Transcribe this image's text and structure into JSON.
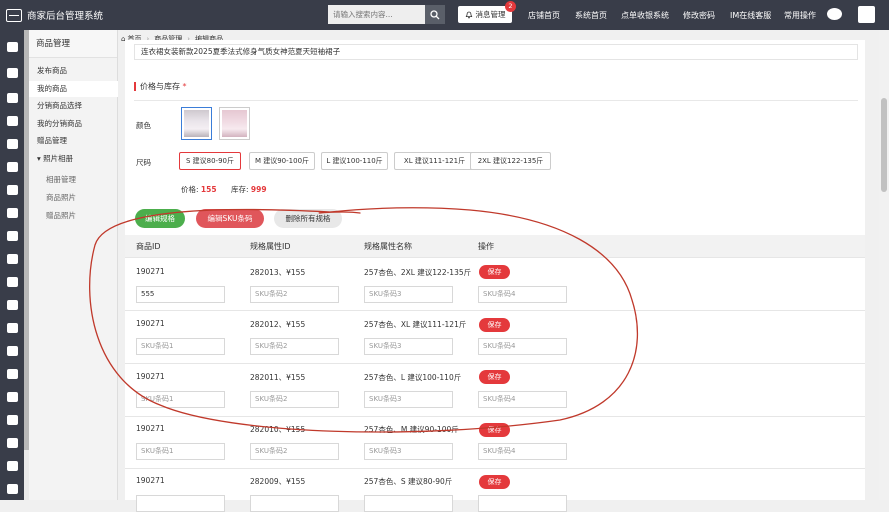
{
  "app": {
    "title": "商家后台管理系统"
  },
  "search": {
    "placeholder": "请输入搜索内容..."
  },
  "messages": {
    "label": "消息管理",
    "count": "2"
  },
  "topnav": [
    "店铺首页",
    "系统首页",
    "点单收银系统",
    "修改密码",
    "IM在线客服",
    "常用操作"
  ],
  "sidebar": {
    "title": "商品管理",
    "items": [
      "发布商品",
      "我的商品",
      "分销商品选择",
      "我的分销商品",
      "赠品管理",
      "照片相册",
      "相册管理",
      "商品照片",
      "赠品照片"
    ]
  },
  "breadcrumb": [
    "首页",
    "商品管理",
    "编辑商品"
  ],
  "product": {
    "description": "连衣裙女装新款2025夏季法式修身气质女神范夏天短袖裙子"
  },
  "section": {
    "title": "价格与库存",
    "required_mark": "*"
  },
  "color": {
    "label": "颜色"
  },
  "size": {
    "label": "尺码",
    "options": [
      "S 建议80-90斤",
      "M 建议90-100斤",
      "L 建议100-110斤",
      "XL 建议111-121斤",
      "2XL 建议122-135斤"
    ]
  },
  "price_stock": {
    "price_label": "价格:",
    "price": "155",
    "stock_label": "库存:",
    "stock": "999"
  },
  "actions": {
    "edit_spec": "编辑规格",
    "edit_sku": "编辑SKU条码",
    "delete_all": "删除所有规格"
  },
  "table": {
    "headers": [
      "商品ID",
      "规格属性ID",
      "规格属性名称",
      "操作"
    ],
    "rows": [
      {
        "product_id": "190271",
        "spec_id": "282013、¥155",
        "spec_name": "257杏色、2XL 建议122-135斤",
        "sku1": "555",
        "sku2": "SKU条码2",
        "sku3": "SKU条码3",
        "sku4": "SKU条码4",
        "save": "保存"
      },
      {
        "product_id": "190271",
        "spec_id": "282012、¥155",
        "spec_name": "257杏色、XL 建议111-121斤",
        "sku1": "SKU条码1",
        "sku2": "SKU条码2",
        "sku3": "SKU条码3",
        "sku4": "SKU条码4",
        "save": "保存"
      },
      {
        "product_id": "190271",
        "spec_id": "282011、¥155",
        "spec_name": "257杏色、L 建议100-110斤",
        "sku1": "SKU条码1",
        "sku2": "SKU条码2",
        "sku3": "SKU条码3",
        "sku4": "SKU条码4",
        "save": "保存"
      },
      {
        "product_id": "190271",
        "spec_id": "282010、¥155",
        "spec_name": "257杏色、M 建议90-100斤",
        "sku1": "SKU条码1",
        "sku2": "SKU条码2",
        "sku3": "SKU条码3",
        "sku4": "SKU条码4",
        "save": "保存"
      },
      {
        "product_id": "190271",
        "spec_id": "282009、¥155",
        "spec_name": "257杏色、S 建议80-90斤",
        "sku1": "",
        "sku2": "",
        "sku3": "",
        "sku4": "",
        "save": "保存"
      }
    ]
  },
  "colors": {
    "accent": "#e4393c",
    "header": "#393d49",
    "green": "#4cae4c",
    "annotation": "#c0392b"
  }
}
